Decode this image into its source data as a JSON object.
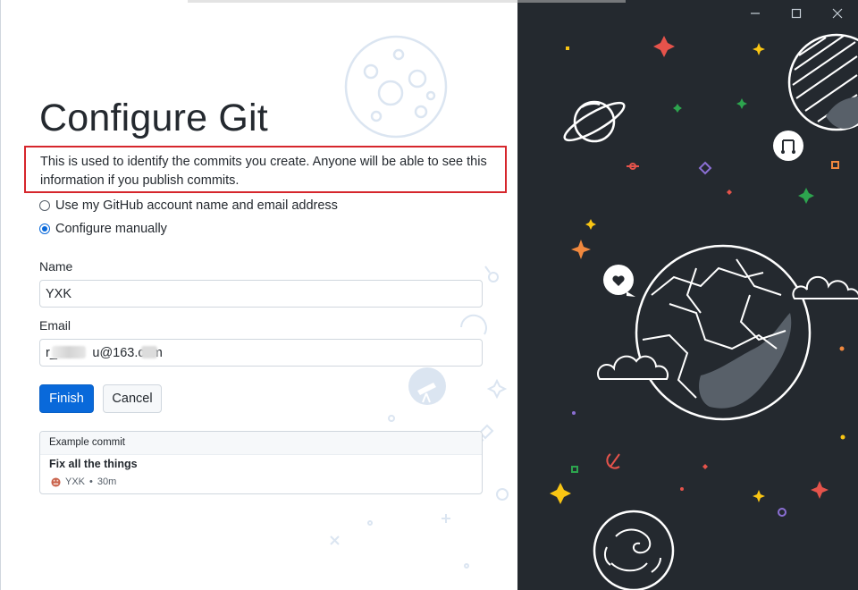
{
  "app": {
    "title": "Configure Git",
    "intro": "This is used to identify the commits you create. Anyone will be able to see this information if you publish commits."
  },
  "options": [
    {
      "label": "Use my GitHub account name and email address",
      "selected": false
    },
    {
      "label": "Configure manually",
      "selected": true
    }
  ],
  "form": {
    "name_label": "Name",
    "name_value": "YXK",
    "email_label": "Email",
    "email_value": "r_zon    u@163.com"
  },
  "buttons": {
    "finish": "Finish",
    "cancel": "Cancel"
  },
  "example": {
    "header": "Example commit",
    "summary": "Fix all the things",
    "author": "YXK",
    "separator": "•",
    "time": "30m"
  },
  "icons": {
    "minimize": "minimize-icon",
    "maximize": "maximize-icon",
    "close": "close-icon",
    "avatar": "avatar-icon"
  },
  "colors": {
    "accent": "#0969da",
    "highlight_border": "#d6262c",
    "dark_panel": "#24292f",
    "star_red": "#e5534b",
    "star_yellow": "#f9c513",
    "star_green": "#2da44e",
    "star_orange": "#f0883e",
    "star_purple": "#8b6fd4"
  }
}
